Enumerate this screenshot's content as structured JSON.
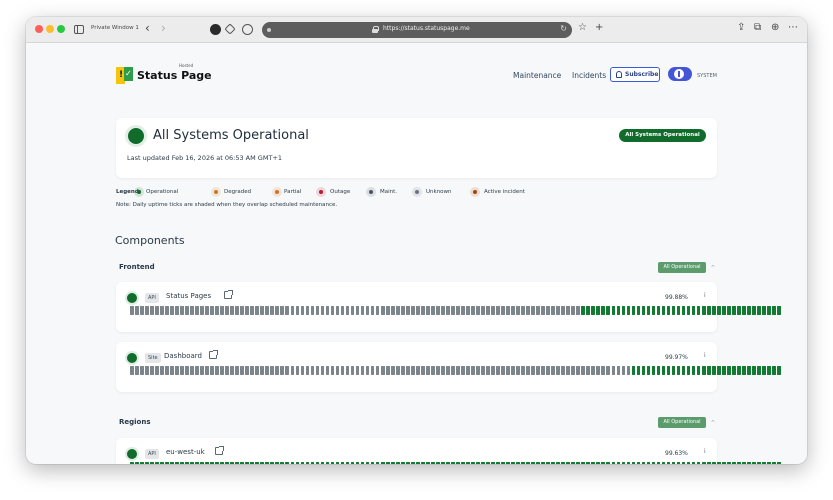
{
  "browser": {
    "window_label": "Private Window 1",
    "url": "https://status.statuspage.me"
  },
  "header": {
    "brand": "Status Page",
    "brand_sub": "Hosted",
    "nav": [
      "Maintenance",
      "Incidents"
    ],
    "subscribe_label": "Subscribe",
    "theme_label": "SYSTEM"
  },
  "summary": {
    "title": "All Systems Operational",
    "updated": "Last updated Feb 16, 2026 at 06:53 AM GMT+1",
    "badge": "All Systems Operational",
    "status_color": "#116b2b"
  },
  "legend": {
    "title": "Legend:",
    "items": [
      {
        "label": "Operational",
        "color": "#116b2b"
      },
      {
        "label": "Degraded",
        "color": "#c97a1e"
      },
      {
        "label": "Partial",
        "color": "#d9711c"
      },
      {
        "label": "Outage",
        "color": "#c0182f"
      },
      {
        "label": "Maint.",
        "color": "#4b5560"
      },
      {
        "label": "Unknown",
        "color": "#6b7580"
      },
      {
        "label": "Active incident",
        "color": "#a84310"
      }
    ],
    "note": "Note: Daily uptime ticks are shaded when they overlap scheduled maintenance."
  },
  "components": {
    "title": "Components",
    "groups": [
      {
        "name": "Frontend",
        "badge": "All Operational",
        "items": [
          {
            "tag": "API",
            "name": "Status Pages",
            "uptime": "99.88%",
            "maint_days": 90,
            "ok_days": 40
          },
          {
            "tag": "Site",
            "name": "Dashboard",
            "uptime": "99.97%",
            "maint_days": 100,
            "ok_days": 30
          }
        ]
      },
      {
        "name": "Regions",
        "badge": "All Operational",
        "items": [
          {
            "tag": "API",
            "name": "eu-west-uk",
            "uptime": "99.63%",
            "maint_days": 0,
            "ok_days": 130
          }
        ]
      }
    ]
  }
}
